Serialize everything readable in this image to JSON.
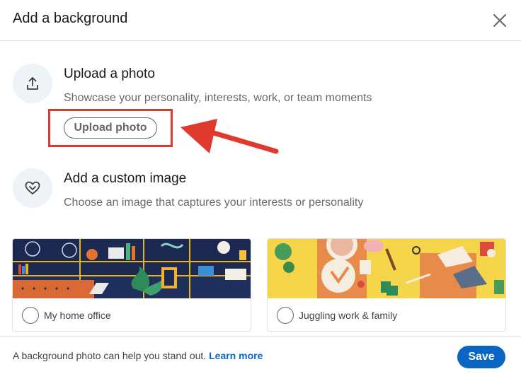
{
  "dialog": {
    "title": "Add a background",
    "close_icon": "close-icon"
  },
  "upload": {
    "icon": "upload-icon",
    "title": "Upload a photo",
    "description": "Showcase your personality, interests, work, or team moments",
    "button_label": "Upload photo"
  },
  "custom": {
    "icon": "heart-icon",
    "title": "Add a custom image",
    "description": "Choose an image that captures your interests or personality"
  },
  "images": [
    {
      "label": "My home office",
      "selected": false
    },
    {
      "label": "Juggling work & family",
      "selected": false
    }
  ],
  "footer": {
    "text": "A background photo can help you stand out.",
    "link": "Learn more",
    "save_label": "Save"
  },
  "colors": {
    "accent": "#0a66c2",
    "annotation": "#e03a2f",
    "icon_circle": "#eef3f8"
  }
}
